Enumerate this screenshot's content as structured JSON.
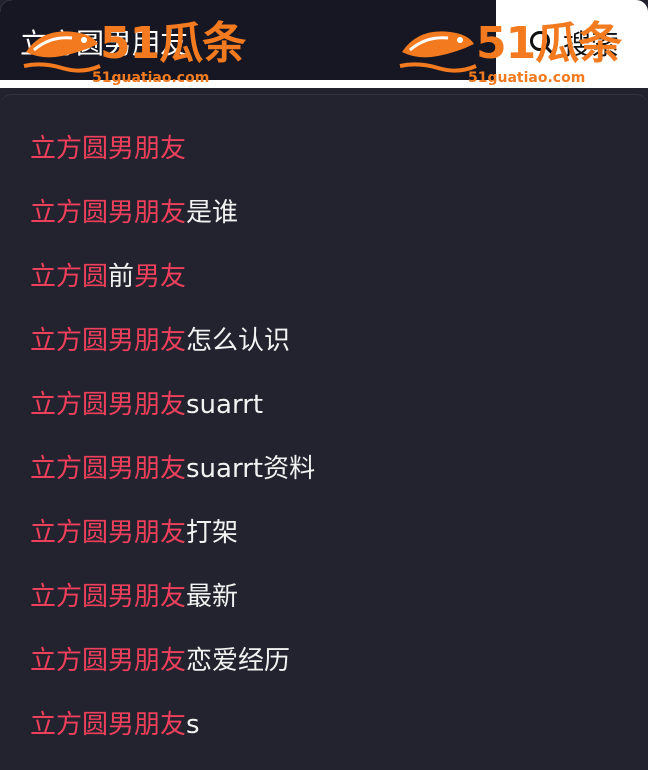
{
  "search": {
    "value": "立方圆男朋友",
    "button_label": "搜索",
    "icon": "search-icon"
  },
  "suggestions": [
    {
      "highlight": "立方圆男朋友",
      "rest": ""
    },
    {
      "highlight": "立方圆男朋友",
      "rest": "是谁"
    },
    {
      "highlight": "立方圆",
      "rest": "前",
      "highlight2": "男友"
    },
    {
      "highlight": "立方圆男朋友",
      "rest": "怎么认识"
    },
    {
      "highlight": "立方圆男朋友",
      "rest": "suarrt"
    },
    {
      "highlight": "立方圆男朋友",
      "rest": "suarrt资料"
    },
    {
      "highlight": "立方圆男朋友",
      "rest": "打架"
    },
    {
      "highlight": "立方圆男朋友",
      "rest": "最新"
    },
    {
      "highlight": "立方圆男朋友",
      "rest": "恋爱经历"
    },
    {
      "highlight": "立方圆男朋友",
      "rest": "s"
    }
  ],
  "watermark": {
    "main_text": "51瓜条",
    "sub_text": "51guatiao.com"
  },
  "colors": {
    "highlight": "#ef3f5b",
    "normal_text": "#f2f2f2",
    "panel_bg": "#23232f",
    "watermark": "#f47a1f"
  }
}
